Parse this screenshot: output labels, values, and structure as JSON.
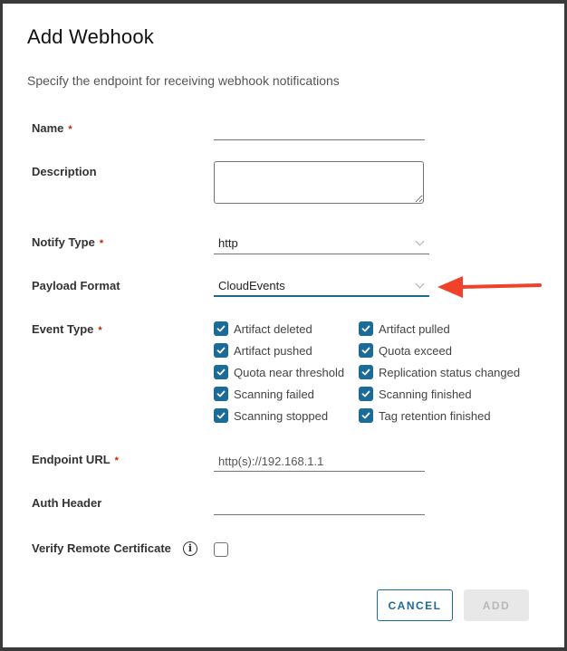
{
  "dialog": {
    "title": "Add Webhook",
    "subtitle": "Specify the endpoint for receiving webhook notifications"
  },
  "form": {
    "name": {
      "label": "Name",
      "required": "*",
      "value": ""
    },
    "description": {
      "label": "Description",
      "value": ""
    },
    "notify_type": {
      "label": "Notify Type",
      "required": "*",
      "value": "http"
    },
    "payload_format": {
      "label": "Payload Format",
      "value": "CloudEvents"
    },
    "event_type": {
      "label": "Event Type",
      "required": "*",
      "options": [
        {
          "label": "Artifact deleted",
          "checked": true
        },
        {
          "label": "Artifact pulled",
          "checked": true
        },
        {
          "label": "Artifact pushed",
          "checked": true
        },
        {
          "label": "Quota exceed",
          "checked": true
        },
        {
          "label": "Quota near threshold",
          "checked": true
        },
        {
          "label": "Replication status changed",
          "checked": true
        },
        {
          "label": "Scanning failed",
          "checked": true
        },
        {
          "label": "Scanning finished",
          "checked": true
        },
        {
          "label": "Scanning stopped",
          "checked": true
        },
        {
          "label": "Tag retention finished",
          "checked": true
        }
      ]
    },
    "endpoint_url": {
      "label": "Endpoint URL",
      "required": "*",
      "placeholder": "http(s)://192.168.1.1",
      "value": ""
    },
    "auth_header": {
      "label": "Auth Header",
      "value": ""
    },
    "verify_cert": {
      "label": "Verify Remote Certificate",
      "checked": false,
      "info_icon": "info-icon"
    }
  },
  "buttons": {
    "cancel": "CANCEL",
    "add": "ADD"
  },
  "annotation": {
    "type": "arrow",
    "color": "#f0412a",
    "points_to": "payload-format-select"
  },
  "colors": {
    "accent": "#1a6b9a",
    "required": "#c92100",
    "disabled_bg": "#e8e8e8"
  }
}
